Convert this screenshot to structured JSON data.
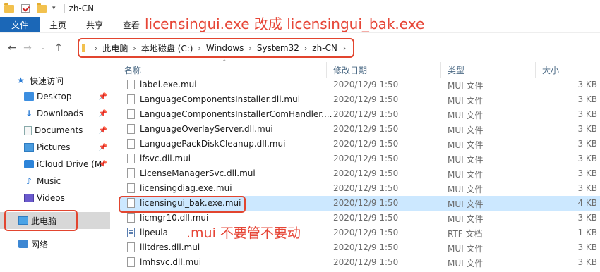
{
  "titlebar": {
    "title": "zh-CN",
    "icons": [
      "folder-icon",
      "properties-check-icon",
      "folder-icon",
      "dropdown-icon"
    ]
  },
  "ribbon": {
    "tabs": [
      "文件",
      "主页",
      "共享",
      "查看"
    ],
    "accent": "#1b67b7"
  },
  "annotations": {
    "rename_note": "licensingui.exe  改成   licensingui_bak.exe",
    "mui_note": ".mui 不要管不要动",
    "color": "#e64536"
  },
  "address": {
    "crumbs": [
      "此电脑",
      "本地磁盘 (C:)",
      "Windows",
      "System32",
      "zh-CN"
    ]
  },
  "sidebar": {
    "items": [
      {
        "label": "快速访问",
        "icon": "star-icon"
      },
      {
        "label": "Desktop",
        "icon": "desktop-icon",
        "pinned": true
      },
      {
        "label": "Downloads",
        "icon": "downloads-icon",
        "pinned": true
      },
      {
        "label": "Documents",
        "icon": "documents-icon",
        "pinned": true
      },
      {
        "label": "Pictures",
        "icon": "pictures-icon",
        "pinned": true
      },
      {
        "label": "iCloud Drive (M",
        "icon": "icloud-icon",
        "pinned": true
      },
      {
        "label": "Music",
        "icon": "music-icon"
      },
      {
        "label": "Videos",
        "icon": "videos-icon"
      },
      {
        "label": "此电脑",
        "icon": "this-pc-icon",
        "selected": true
      },
      {
        "label": "网络",
        "icon": "network-icon"
      }
    ]
  },
  "columns": [
    "名称",
    "修改日期",
    "类型",
    "大小"
  ],
  "files": [
    {
      "name": "label.exe.mui",
      "date": "2020/12/9 1:50",
      "type": "MUI 文件",
      "size": "3 KB"
    },
    {
      "name": "LanguageComponentsInstaller.dll.mui",
      "date": "2020/12/9 1:50",
      "type": "MUI 文件",
      "size": "3 KB"
    },
    {
      "name": "LanguageComponentsInstallerComHandler....",
      "date": "2020/12/9 1:50",
      "type": "MUI 文件",
      "size": "3 KB"
    },
    {
      "name": "LanguageOverlayServer.dll.mui",
      "date": "2020/12/9 1:50",
      "type": "MUI 文件",
      "size": "3 KB"
    },
    {
      "name": "LanguagePackDiskCleanup.dll.mui",
      "date": "2020/12/9 1:50",
      "type": "MUI 文件",
      "size": "3 KB"
    },
    {
      "name": "lfsvc.dll.mui",
      "date": "2020/12/9 1:50",
      "type": "MUI 文件",
      "size": "3 KB"
    },
    {
      "name": "LicenseManagerSvc.dll.mui",
      "date": "2020/12/9 1:50",
      "type": "MUI 文件",
      "size": "3 KB"
    },
    {
      "name": "licensingdiag.exe.mui",
      "date": "2020/12/9 1:50",
      "type": "MUI 文件",
      "size": "3 KB"
    },
    {
      "name": "licensingui_bak.exe.mui",
      "date": "2020/12/9 1:50",
      "type": "MUI 文件",
      "size": "4 KB",
      "selected": true
    },
    {
      "name": "licmgr10.dll.mui",
      "date": "2020/12/9 1:50",
      "type": "MUI 文件",
      "size": "3 KB"
    },
    {
      "name": "lipeula",
      "date": "2020/12/9 1:50",
      "type": "RTF 文档",
      "size": "1 KB",
      "rtf": true
    },
    {
      "name": "llltdres.dll.mui",
      "date": "2020/12/9 1:50",
      "type": "MUI 文件",
      "size": "3 KB"
    },
    {
      "name": "lmhsvc.dll.mui",
      "date": "2020/12/9 1:50",
      "type": "MUI 文件",
      "size": "3 KB"
    }
  ]
}
